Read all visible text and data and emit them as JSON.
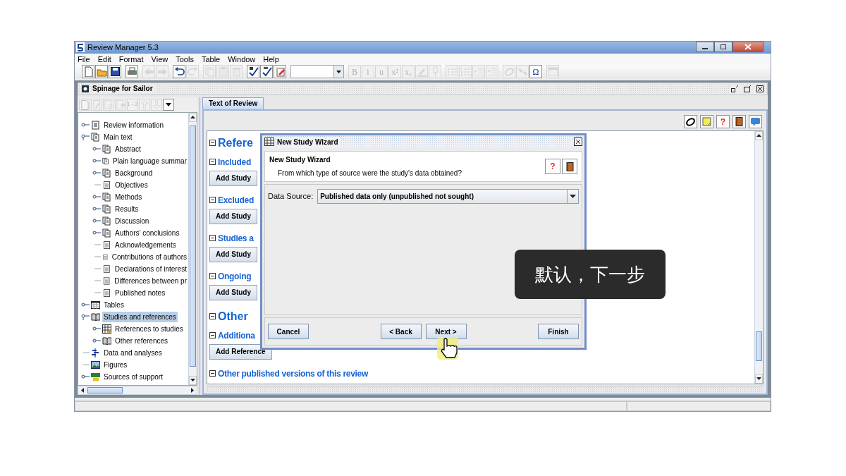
{
  "window": {
    "title": "Review Manager 5.3"
  },
  "menu": [
    "File",
    "Edit",
    "Format",
    "View",
    "Tools",
    "Table",
    "Window",
    "Help"
  ],
  "toolbar": [
    [
      {
        "kind": "new",
        "disabled": false
      },
      {
        "kind": "open",
        "disabled": false
      },
      {
        "kind": "save",
        "disabled": false
      }
    ],
    [
      {
        "kind": "print",
        "disabled": false
      }
    ],
    [
      {
        "kind": "back",
        "disabled": true
      },
      {
        "kind": "forward",
        "disabled": true
      }
    ],
    [
      {
        "kind": "undo",
        "disabled": false
      },
      {
        "kind": "redo",
        "disabled": true
      }
    ],
    [
      {
        "kind": "copy",
        "disabled": true
      },
      {
        "kind": "paste",
        "disabled": true
      },
      {
        "kind": "delete",
        "disabled": true
      }
    ],
    [
      {
        "kind": "check",
        "disabled": false
      },
      {
        "kind": "spell",
        "disabled": false
      },
      {
        "kind": "tag",
        "disabled": false
      }
    ],
    [
      {
        "kind": "combo"
      }
    ],
    [
      {
        "kind": "text",
        "label": "B",
        "disabled": true
      },
      {
        "kind": "text",
        "label": "i",
        "disabled": true
      },
      {
        "kind": "text",
        "label": "u",
        "disabled": true
      },
      {
        "kind": "text",
        "label": "x²",
        "disabled": true
      },
      {
        "kind": "text",
        "label": "x₂",
        "disabled": true
      },
      {
        "kind": "pen",
        "disabled": true
      },
      {
        "kind": "pin",
        "disabled": true
      }
    ],
    [
      {
        "kind": "bullets",
        "disabled": true
      },
      {
        "kind": "numbers",
        "disabled": true
      },
      {
        "kind": "indent",
        "disabled": true
      },
      {
        "kind": "outdent",
        "disabled": true
      }
    ],
    [
      {
        "kind": "link",
        "disabled": true
      },
      {
        "kind": "unlink",
        "disabled": true
      },
      {
        "kind": "text",
        "label": "Ω",
        "disabled": false
      }
    ],
    [
      {
        "kind": "table",
        "disabled": true
      }
    ]
  ],
  "document_window": {
    "title": "Spinage for Sailor"
  },
  "tree_toolbar": [
    {
      "kind": "new",
      "disabled": true
    },
    {
      "kind": "edit",
      "disabled": true
    },
    {
      "kind": "find",
      "disabled": true
    },
    {
      "kind": "rename",
      "disabled": true
    },
    {
      "kind": "text",
      "label": "1→2",
      "disabled": true
    },
    {
      "kind": "up",
      "disabled": true
    },
    {
      "kind": "down",
      "disabled": true
    },
    {
      "kind": "dropdown",
      "disabled": false
    }
  ],
  "tree": [
    {
      "kind": "lines",
      "label": "Review information",
      "expanded": false,
      "selected": false
    },
    {
      "kind": "pages",
      "label": "Main text",
      "expanded": true,
      "selected": false,
      "children": [
        {
          "kind": "pages",
          "label": "Abstract",
          "expanded": false,
          "selected": false
        },
        {
          "kind": "pages",
          "label": "Plain language summar",
          "expanded": false,
          "selected": false
        },
        {
          "kind": "pages",
          "label": "Background",
          "expanded": false,
          "selected": false
        },
        {
          "kind": "page",
          "label": "Objectives",
          "selected": false
        },
        {
          "kind": "pages",
          "label": "Methods",
          "expanded": false,
          "selected": false
        },
        {
          "kind": "pages",
          "label": "Results",
          "expanded": false,
          "selected": false
        },
        {
          "kind": "pages",
          "label": "Discussion",
          "expanded": false,
          "selected": false
        },
        {
          "kind": "pages",
          "label": "Authors' conclusions",
          "expanded": false,
          "selected": false
        },
        {
          "kind": "page",
          "label": "Acknowledgements",
          "selected": false
        },
        {
          "kind": "page",
          "label": "Contributions of authors",
          "selected": false
        },
        {
          "kind": "page",
          "label": "Declarations of interest",
          "selected": false
        },
        {
          "kind": "page",
          "label": "Differences between pr",
          "selected": false
        },
        {
          "kind": "page",
          "label": "Published notes",
          "selected": false
        }
      ]
    },
    {
      "kind": "table",
      "label": "Tables",
      "expanded": false,
      "selected": false
    },
    {
      "kind": "book",
      "label": "Studies and references",
      "expanded": true,
      "selected": true,
      "children": [
        {
          "kind": "grid",
          "label": "References to studies",
          "expanded": false,
          "selected": false
        },
        {
          "kind": "book",
          "label": "Other references",
          "expanded": false,
          "selected": false
        }
      ]
    },
    {
      "kind": "forest",
      "label": "Data and analyses",
      "selected": false
    },
    {
      "kind": "picture",
      "label": "Figures",
      "selected": false
    },
    {
      "kind": "money",
      "label": "Sources of support",
      "expanded": false,
      "selected": false
    }
  ],
  "tabs": [
    {
      "label": "Text of Review",
      "selected": true
    }
  ],
  "review_toolbar": [
    {
      "kind": "link"
    },
    {
      "kind": "note"
    },
    {
      "kind": "help",
      "label": "?"
    },
    {
      "kind": "book"
    },
    {
      "kind": "comment"
    }
  ],
  "document": [
    {
      "kind": "major",
      "heading": "Refere",
      "expanded": true
    },
    {
      "kind": "minor",
      "heading": "Included",
      "expanded": true,
      "button": "Add Study"
    },
    {
      "kind": "minor",
      "heading": "Excluded",
      "expanded": true,
      "button": "Add Study"
    },
    {
      "kind": "minor",
      "heading": "Studies a",
      "expanded": true,
      "button": "Add Study"
    },
    {
      "kind": "minor",
      "heading": "Ongoing",
      "expanded": true,
      "button": "Add Study"
    },
    {
      "kind": "major",
      "heading": "Other",
      "expanded": true
    },
    {
      "kind": "minor",
      "heading": "Additiona",
      "expanded": true,
      "button": "Add Reference"
    },
    {
      "kind": "minor",
      "heading": "Other published versions of this review",
      "expanded": true
    }
  ],
  "dialog": {
    "title": "New Study Wizard",
    "heading": "New Study Wizard",
    "prompt": "From which type of source were the study's data obtained?",
    "field_label": "Data Source:",
    "field_value": "Published data only (unpublished not sought)",
    "tools": [
      {
        "kind": "help",
        "label": "?"
      },
      {
        "kind": "book"
      }
    ],
    "buttons": [
      {
        "kind": "left",
        "label": "Cancel"
      },
      {
        "kind": "middle",
        "label": "< Back"
      },
      {
        "kind": "middle",
        "label": "Next >"
      },
      {
        "kind": "right",
        "label": "Finish"
      }
    ]
  },
  "caption": "默认，下一步"
}
